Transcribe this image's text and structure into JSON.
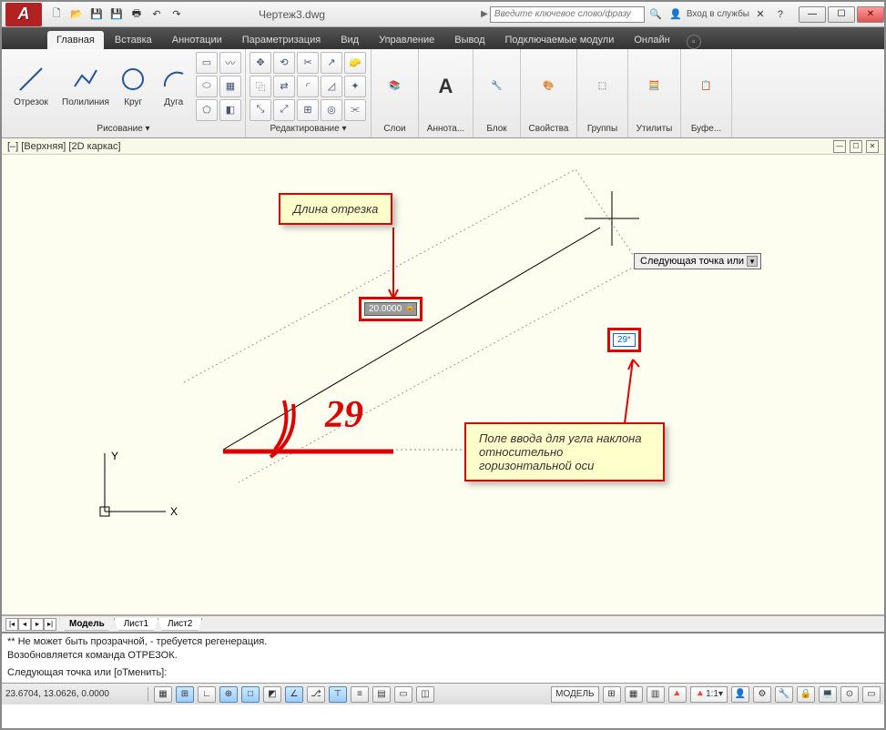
{
  "app": {
    "logo_letter": "A",
    "document_title": "Чертеж3.dwg",
    "search_placeholder": "Введите ключевое слово/фразу",
    "signin_label": "Вход в службы"
  },
  "qat_icons": [
    "new",
    "open",
    "save",
    "saveas",
    "print",
    "undo",
    "redo"
  ],
  "tabs": {
    "items": [
      {
        "label": "Главная",
        "active": true
      },
      {
        "label": "Вставка"
      },
      {
        "label": "Аннотации"
      },
      {
        "label": "Параметризация"
      },
      {
        "label": "Вид"
      },
      {
        "label": "Управление"
      },
      {
        "label": "Вывод"
      },
      {
        "label": "Подключаемые модули"
      },
      {
        "label": "Онлайн"
      }
    ]
  },
  "ribbon": {
    "draw": {
      "title": "Рисование ▾",
      "line": "Отрезок",
      "polyline": "Полилиния",
      "circle": "Круг",
      "arc": "Дуга"
    },
    "edit": {
      "title": "Редактирование ▾"
    },
    "layers": {
      "title": "Слои"
    },
    "annot": {
      "title": "Аннота..."
    },
    "block": {
      "title": "Блок"
    },
    "prop": {
      "title": "Свойства"
    },
    "groups": {
      "title": "Группы"
    },
    "util": {
      "title": "Утилиты"
    },
    "clip": {
      "title": "Буфе..."
    }
  },
  "viewport": {
    "label": "[–] [Верхняя] [2D каркас]"
  },
  "drawing": {
    "length_value": "20.0000",
    "angle_value": "29",
    "prompt_tooltip": "Следующая точка или",
    "hand_annotation": "29",
    "ucs_x": "X",
    "ucs_y": "Y"
  },
  "callouts": {
    "length": "Длина отрезка",
    "angle": "Поле ввода для угла наклона относительно горизонтальной оси"
  },
  "sheets": {
    "model": "Модель",
    "sheet1": "Лист1",
    "sheet2": "Лист2"
  },
  "command": {
    "line1": "** Не может быть прозрачной, - требуется регенерация.",
    "line2": "Возобновляется команда ОТРЕЗОК.",
    "prompt": "Следующая точка или [оТменить]:"
  },
  "status": {
    "coords": "23.6704, 13.0626, 0.0000",
    "model": "МОДЕЛЬ",
    "scale": "1:1"
  }
}
